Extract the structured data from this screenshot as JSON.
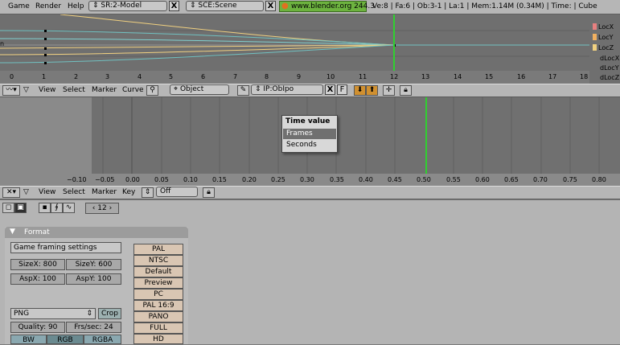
{
  "topbar": {
    "menus": [
      "Game",
      "Render",
      "Help"
    ],
    "screen": "SR:2-Model",
    "scene": "SCE:Scene",
    "url": "www.blender.org 244.3",
    "stats": "Ve:8 | Fa:6 | Ob:3-1 | La:1  | Mem:1.14M (0.34M)  | Time:  | Cube",
    "close": "X"
  },
  "ipo": {
    "channels": [
      {
        "label": "LocX",
        "color": "#e88080"
      },
      {
        "label": "LocY",
        "color": "#f0b060"
      },
      {
        "label": "LocZ",
        "color": "#f0d080"
      },
      {
        "label": "dLocX",
        "color": ""
      },
      {
        "label": "dLocY",
        "color": ""
      },
      {
        "label": "dLocZ",
        "color": ""
      }
    ],
    "ticks": [
      "0",
      "1",
      "2",
      "3",
      "4",
      "5",
      "6",
      "7",
      "8",
      "9",
      "10",
      "11",
      "12",
      "13",
      "14",
      "15",
      "16",
      "17",
      "18"
    ],
    "current_frame": 12,
    "header": {
      "menus": [
        "View",
        "Select",
        "Marker",
        "Curve"
      ],
      "object_mode": "Object",
      "ipo_name": "IP:ObIpo",
      "x": "X",
      "f": "F"
    }
  },
  "action": {
    "ticks": [
      "−0.10",
      "−0.05",
      "0.00",
      "0.05",
      "0.10",
      "0.15",
      "0.20",
      "0.25",
      "0.30",
      "0.35",
      "0.40",
      "0.45",
      "0.50",
      "0.55",
      "0.60",
      "0.65",
      "0.70",
      "0.75",
      "0.80"
    ],
    "current": 0.5,
    "popup": {
      "title": "Time value",
      "items": [
        "Frames",
        "Seconds"
      ],
      "selected": 0
    },
    "header": {
      "menus": [
        "View",
        "Select",
        "Marker",
        "Key"
      ],
      "mode": "Off"
    }
  },
  "buttons": {
    "frame": "12",
    "panel_title": "Format",
    "game_framing": "Game framing settings",
    "size_x": "SizeX: 800",
    "size_y": "SizeY: 600",
    "asp_x": "AspX: 100",
    "asp_y": "AspY: 100",
    "file_type": "PNG",
    "crop": "Crop",
    "quality": "Quality: 90",
    "fps": "Frs/sec: 24",
    "color_modes": [
      "BW",
      "RGB",
      "RGBA"
    ],
    "presets": [
      "PAL",
      "NTSC",
      "Default",
      "Preview",
      "PC",
      "PAL 16:9",
      "PANO",
      "FULL",
      "HD"
    ]
  }
}
